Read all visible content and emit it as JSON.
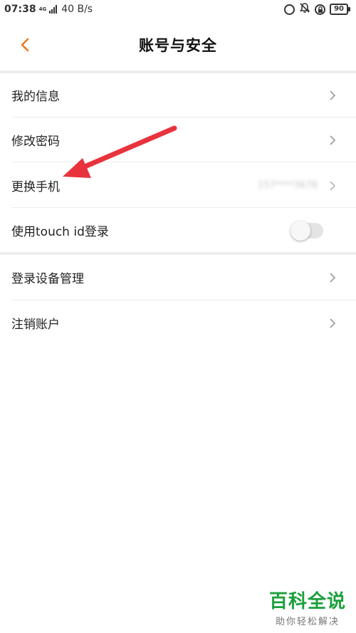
{
  "status_bar": {
    "time": "07:38",
    "network": "4G",
    "speed": "40 B/s",
    "battery": "90"
  },
  "header": {
    "title": "账号与安全",
    "back_icon": "chevron-left-icon",
    "accent_color": "#f07a1e"
  },
  "settings": {
    "my_info": "我的信息",
    "change_password": "修改密码",
    "change_phone": "更换手机",
    "phone_masked": "157****3678",
    "touch_id_label": "使用touch id登录",
    "touch_id_enabled": false,
    "device_management": "登录设备管理",
    "cancel_account": "注销账户"
  },
  "annotation": {
    "arrow_color": "#e8333c"
  },
  "watermark": {
    "title": "百科全说",
    "subtitle": "助你轻松解决",
    "color": "#1aa03c"
  }
}
